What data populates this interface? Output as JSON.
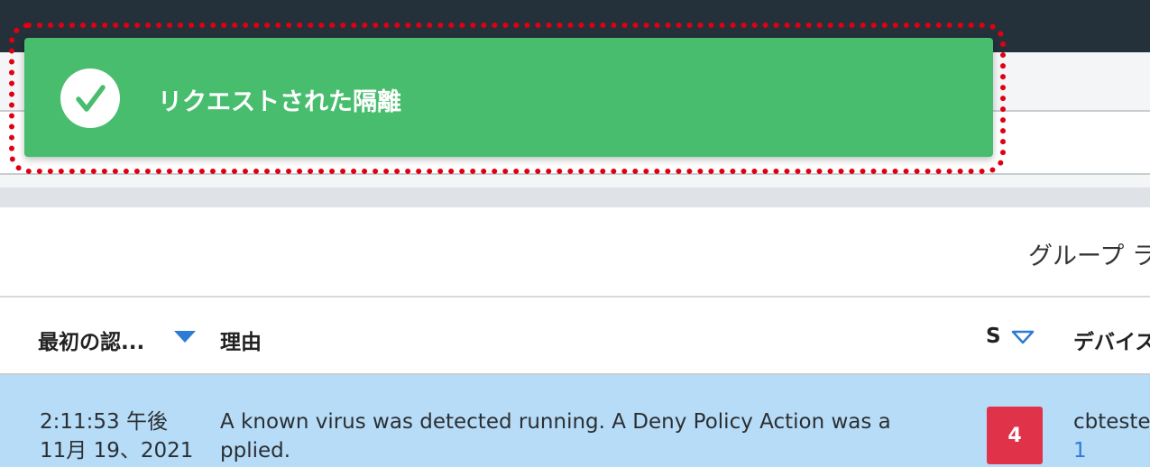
{
  "toast": {
    "message": "リクエストされた隔離",
    "icon": "check-circle-icon",
    "color": "#48bd6e",
    "highlight_color": "#e00012"
  },
  "group": {
    "label": "グループ ラ"
  },
  "table": {
    "columns": [
      {
        "label": "最初の認...",
        "sort": "sort-desc-icon"
      },
      {
        "label": "理由"
      },
      {
        "label": "S",
        "sort": "sort-desc-outline-icon"
      },
      {
        "label": "デバイス"
      }
    ],
    "row": {
      "time": "2:11:53 午後",
      "date": "11月 19、2021",
      "reason_line1": "A known virus was detected running. A Deny Policy Action was a",
      "reason_line2": "pplied.",
      "severity": "4",
      "severity_color": "#e0334a",
      "device_name": "cbteste",
      "device_count": "1"
    }
  }
}
